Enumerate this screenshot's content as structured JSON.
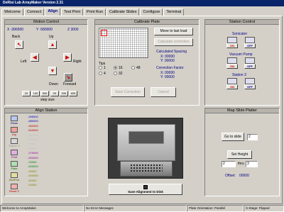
{
  "window": {
    "title": "DeRisi Lab ArrayMaker Version 2.31"
  },
  "tabs": [
    {
      "label": "Welcome",
      "active": false
    },
    {
      "label": "Connect",
      "active": false
    },
    {
      "label": "Align",
      "active": true
    },
    {
      "label": "Test Print",
      "active": false
    },
    {
      "label": "Print Run",
      "active": false
    },
    {
      "label": "Calibrate Slides",
      "active": false
    },
    {
      "label": "Configure",
      "active": false
    },
    {
      "label": "Terminal",
      "active": false
    }
  ],
  "motion": {
    "title": "Motion Control",
    "x": "X -396500",
    "y": "Y -580000",
    "z": "Z 3000",
    "back": "Back",
    "up": "Up",
    "left": "Left",
    "right": "Right",
    "down": "Down",
    "forward": "Forward",
    "steps": [
      "20",
      "100",
      "500",
      "2K",
      "20K",
      "40K"
    ],
    "step_size_label": "step size"
  },
  "calibrate": {
    "title": "Calibrate Plate",
    "move_last": "Move to last load",
    "calc_correction": "Calculate correction",
    "spacing_label": "Calculated Spacing",
    "spacing_x": "X: 00000",
    "spacing_y": "Y: 00000",
    "cf_label": "Correction Factor",
    "cf_x": "X: 00000",
    "cf_y": "Y: 00000",
    "tips_label": "Tips",
    "tips": [
      {
        "label": "1",
        "selected": false
      },
      {
        "label": "16",
        "selected": true
      },
      {
        "label": "48",
        "selected": false
      },
      {
        "label": "4",
        "selected": false
      },
      {
        "label": "32",
        "selected": false
      }
    ],
    "save": "Save Correction",
    "cancel": "Cancel"
  },
  "station": {
    "title": "Station Control",
    "sonicator": "Sonicator",
    "vacuum": "Vacuum Pump",
    "station3": "Station 3",
    "on": "ON",
    "off": "OFF"
  },
  "align_station": {
    "title": "Align Station",
    "buttons": [
      "Rinse",
      "Dry",
      "Station 3",
      "Print",
      "Plate",
      "BlotPad",
      "Reset Z"
    ],
    "values": [
      {
        "text": "-396500",
        "color": "#0000c0"
      },
      {
        "text": "-580000",
        "color": "#0000c0"
      },
      {
        "text": "-352000",
        "color": "#c00000"
      },
      {
        "text": "-543000",
        "color": "#c00000"
      },
      {
        "text": "-307500",
        "color": "#c0c0c0"
      },
      {
        "text": "-000000",
        "color": "#c0c0c0"
      },
      {
        "text": "-0000",
        "color": "#c0c0c0"
      },
      {
        "text": "-00000",
        "color": "#c0c0c0"
      },
      {
        "text": "-279000",
        "color": "#a000a0"
      },
      {
        "text": "-000000",
        "color": "#a000a0"
      },
      {
        "text": "-23000",
        "color": "#008000"
      },
      {
        "text": "-000000",
        "color": "#008000"
      },
      {
        "text": "-25000",
        "color": "#808000"
      },
      {
        "text": "-000000",
        "color": "#808000"
      },
      {
        "text": "-00000",
        "color": "#808000"
      },
      {
        "text": "-00000",
        "color": "#808000"
      }
    ]
  },
  "save_alignment": "Save Alignment to Disk",
  "map_slide": {
    "title": "Map Slide Platter",
    "goto": "Go to slide",
    "goto_value": "2",
    "set_height": "Set Height",
    "from": "2",
    "thru": "thru",
    "to": "3",
    "offset_label": "Offset:",
    "offset_value": "00000"
  },
  "status": {
    "welcome": "Welcome to ArrayMaker.",
    "errors": "No Error Messages",
    "orientation": "Plate Orientation: Parallel",
    "xstage": "X-Stage: Flipped"
  }
}
